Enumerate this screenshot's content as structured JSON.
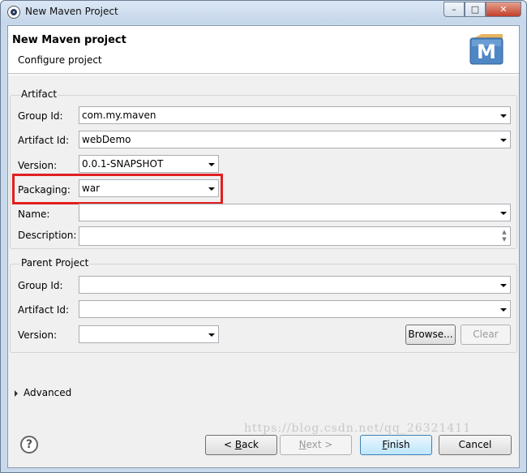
{
  "window": {
    "title": "New Maven Project",
    "controls": {
      "minimize": "–",
      "maximize": "□",
      "close": "✕"
    }
  },
  "header": {
    "title": "New Maven project",
    "description": "Configure project",
    "logo_letter": "M"
  },
  "artifact": {
    "legend": "Artifact",
    "group_id": {
      "label": "Group Id:",
      "value": "com.my.maven"
    },
    "artifact_id": {
      "label": "Artifact Id:",
      "value": "webDemo"
    },
    "version": {
      "label": "Version:",
      "value": "0.0.1-SNAPSHOT"
    },
    "packaging": {
      "label": "Packaging:",
      "value": "war"
    },
    "name": {
      "label": "Name:",
      "value": ""
    },
    "description": {
      "label": "Description:",
      "value": ""
    }
  },
  "parent": {
    "legend": "Parent Project",
    "group_id": {
      "label": "Group Id:",
      "value": ""
    },
    "artifact_id": {
      "label": "Artifact Id:",
      "value": ""
    },
    "version": {
      "label": "Version:",
      "value": ""
    },
    "browse_label": "Browse...",
    "clear_label": "Clear"
  },
  "advanced": {
    "label": "Advanced"
  },
  "footer": {
    "help": "?",
    "back": {
      "prefix": "< ",
      "mnemonic": "B",
      "rest": "ack"
    },
    "next": {
      "mnemonic": "N",
      "rest": "ext >"
    },
    "finish": {
      "mnemonic": "F",
      "rest": "inish"
    },
    "cancel": "Cancel"
  },
  "watermark": "https://blog.csdn.net/qq_26321411",
  "colors": {
    "highlight": "#e02020",
    "title_bar": "#c9d9ec"
  }
}
